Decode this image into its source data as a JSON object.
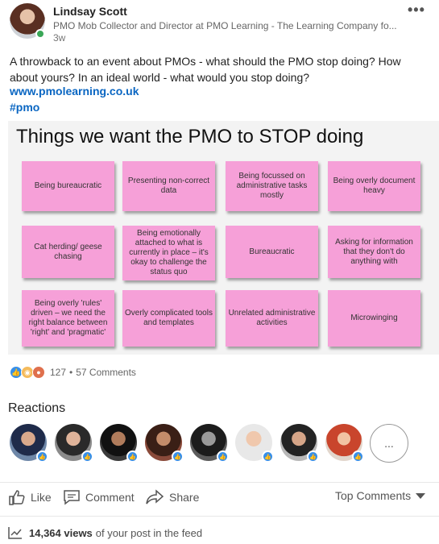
{
  "author": {
    "name": "Lindsay Scott",
    "headline": "PMO Mob Collector and Director at PMO Learning - The Learning Company fo...",
    "time": "3w"
  },
  "post": {
    "text": "A throwback to an event about PMOs - what should the PMO stop doing? How about yours? In an ideal world - what would you stop doing?",
    "link": "www.pmolearning.co.uk",
    "hashtag": "#pmo"
  },
  "image": {
    "title": "Things we want the PMO to STOP doing",
    "notes": [
      "Being bureaucratic",
      "Presenting non-correct data",
      "Being focussed on administrative tasks mostly",
      "Being overly document heavy",
      "Cat herding/ geese chasing",
      "Being emotionally attached to what is currently in place – it's okay to challenge the status quo",
      "Bureaucratic",
      "Asking for information that they don't do anything with",
      "Being overly 'rules' driven – we need the right balance between 'right' and 'pragmatic'",
      "Overly complicated tools and templates",
      "Unrelated administrative activities",
      "Microwinging"
    ]
  },
  "social": {
    "reaction_count": "127",
    "separator": "•",
    "comments": "57 Comments",
    "reaction_icons": [
      "like-icon",
      "idea-icon",
      "curious-icon"
    ]
  },
  "reactions": {
    "title": "Reactions",
    "more": "..."
  },
  "actions": {
    "like": "Like",
    "comment": "Comment",
    "share": "Share",
    "sort": "Top Comments"
  },
  "views": {
    "count": "14,364 views",
    "suffix": "of your post in the feed"
  },
  "colors": {
    "link": "#0a66c2",
    "sticky_note": "#f6a0d8",
    "like": "#378fe9",
    "online": "#3aa757"
  }
}
